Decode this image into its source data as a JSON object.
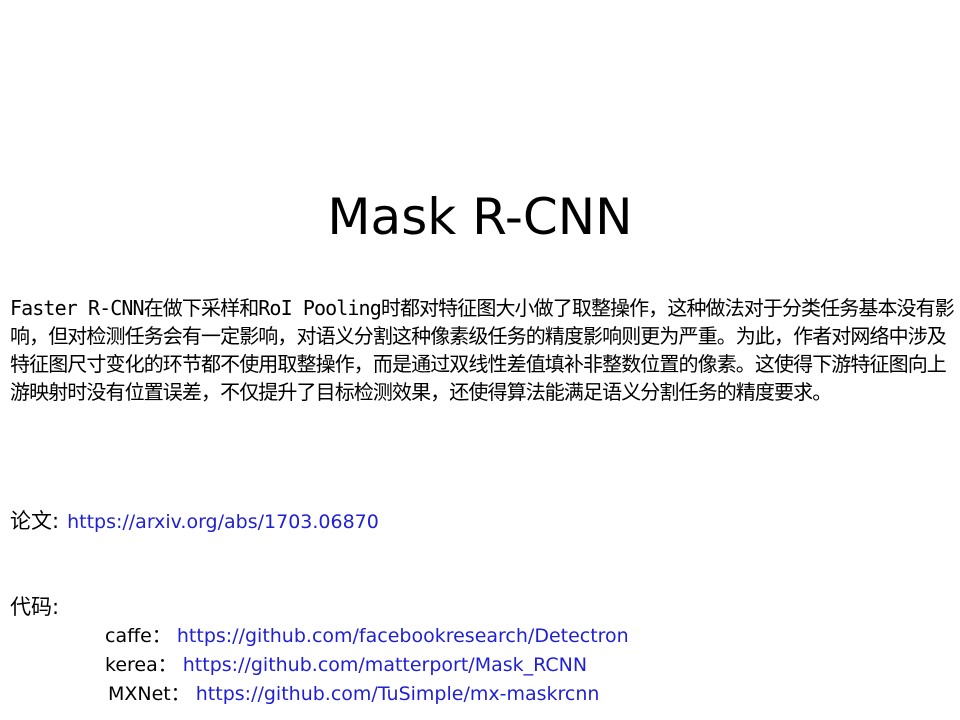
{
  "slide": {
    "title": "Mask R-CNN",
    "body": "Faster R-CNN在做下采样和RoI Pooling时都对特征图大小做了取整操作，这种做法对于分类任务基本没有影响，但对检测任务会有一定影响，对语义分割这种像素级任务的精度影响则更为严重。为此，作者对网络中涉及特征图尺寸变化的环节都不使用取整操作，而是通过双线性差值填补非整数位置的像素。这使得下游特征图向上游映射时没有位置误差，不仅提升了目标检测效果，还使得算法能满足语义分割任务的精度要求。",
    "paper": {
      "label": "论文:",
      "url": "https://arxiv.org/abs/1703.06870"
    },
    "code": {
      "label": "代码:",
      "items": [
        {
          "name": "caffe：",
          "url": "https://github.com/facebookresearch/Detectron"
        },
        {
          "name": "kerea：",
          "url": "https://github.com/matterport/Mask_RCNN"
        },
        {
          "name": "MXNet：",
          "url": "https://github.com/TuSimple/mx-maskrcnn"
        }
      ]
    }
  },
  "colors": {
    "link": "#1f1fd6",
    "text": "#000000",
    "background": "#ffffff"
  }
}
